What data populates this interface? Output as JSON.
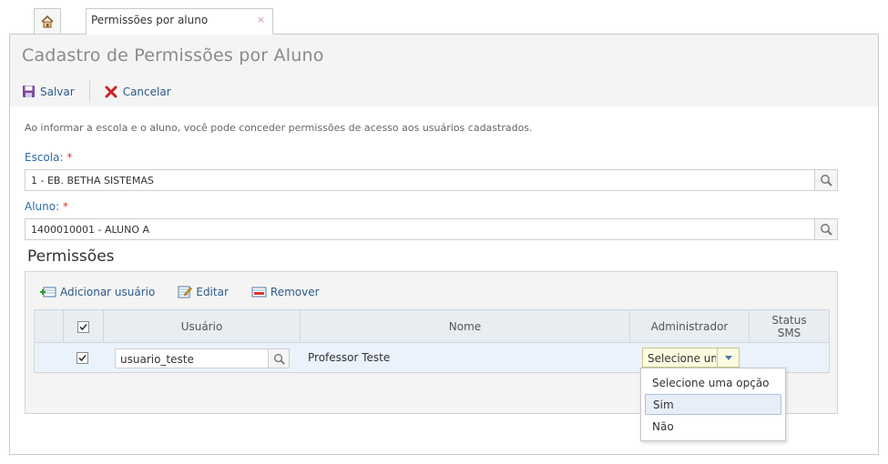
{
  "tabs": {
    "home_icon": "home-icon",
    "active_label": "Permissões por aluno",
    "close_glyph": "×"
  },
  "page": {
    "title": "Cadastro de Permissões por Aluno"
  },
  "toolbar": {
    "save_label": "Salvar",
    "cancel_label": "Cancelar"
  },
  "form": {
    "hint": "Ao informar a escola e o aluno, você pode conceder permissões de acesso aos usuários cadastrados.",
    "escola_label": "Escola:",
    "escola_value": "1 - EB. BETHA SISTEMAS",
    "aluno_label": "Aluno:",
    "aluno_value": "1400010001 - ALUNO A",
    "required_mark": "*"
  },
  "permissions": {
    "title": "Permissões",
    "actions": {
      "add": "Adicionar usuário",
      "edit": "Editar",
      "remove": "Remover"
    },
    "columns": {
      "usuario": "Usuário",
      "nome": "Nome",
      "administrador": "Administrador",
      "status_sms_line1": "Status",
      "status_sms_line2": "SMS"
    },
    "rows": [
      {
        "checked": true,
        "usuario": "usuario_teste",
        "nome": "Professor Teste",
        "administrador": "Selecione uma opção",
        "status_sms": ""
      }
    ],
    "dropdown_options": [
      "Selecione uma opção",
      "Sim",
      "Não"
    ],
    "hovered_option": "Sim"
  },
  "colors": {
    "link": "#2e5b8a",
    "label": "#2e6aa6",
    "required": "#dd3333",
    "cancel_icon": "#cc2222",
    "select_bg": "#fcfce2"
  }
}
